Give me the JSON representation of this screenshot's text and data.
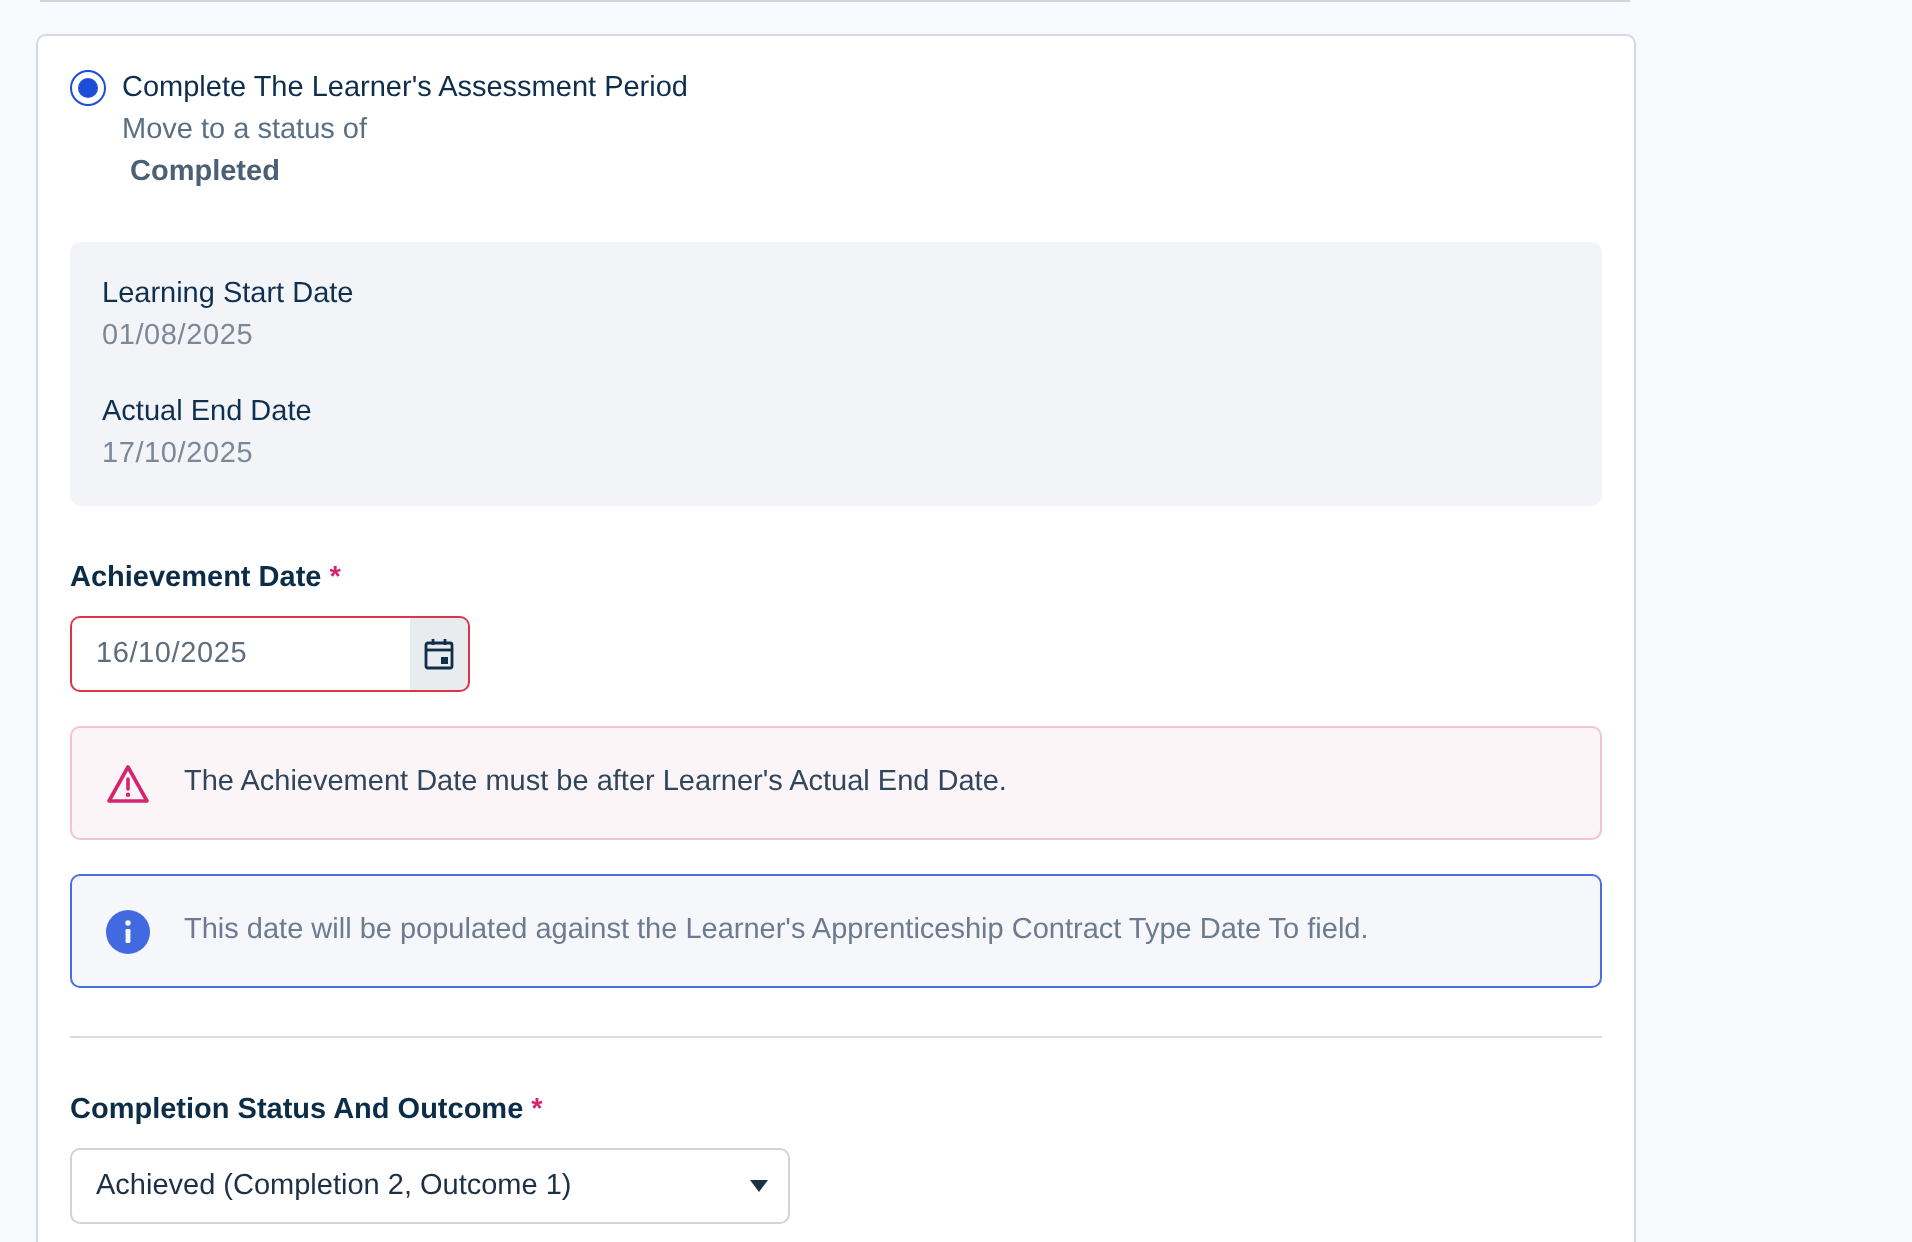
{
  "option": {
    "label": "Complete The Learner's Assessment Period",
    "selected": true,
    "description": "Move to a status of",
    "status": "Completed"
  },
  "details": [
    {
      "label": "Learning Start Date",
      "value": "01/08/2025"
    },
    {
      "label": "Actual End Date",
      "value": "17/10/2025"
    }
  ],
  "achievement_date": {
    "label": "Achievement Date",
    "required_mark": "*",
    "value": "16/10/2025",
    "invalid": true
  },
  "alerts": [
    {
      "kind": "error",
      "text": "The Achievement Date must be after Learner's Actual End Date."
    },
    {
      "kind": "info",
      "text": "This date will be populated against the Learner's Apprenticeship Contract Type Date To field."
    }
  ],
  "completion_status": {
    "label": "Completion Status And Outcome",
    "required_mark": "*",
    "value": "Achieved (Completion 2, Outcome 1)"
  }
}
